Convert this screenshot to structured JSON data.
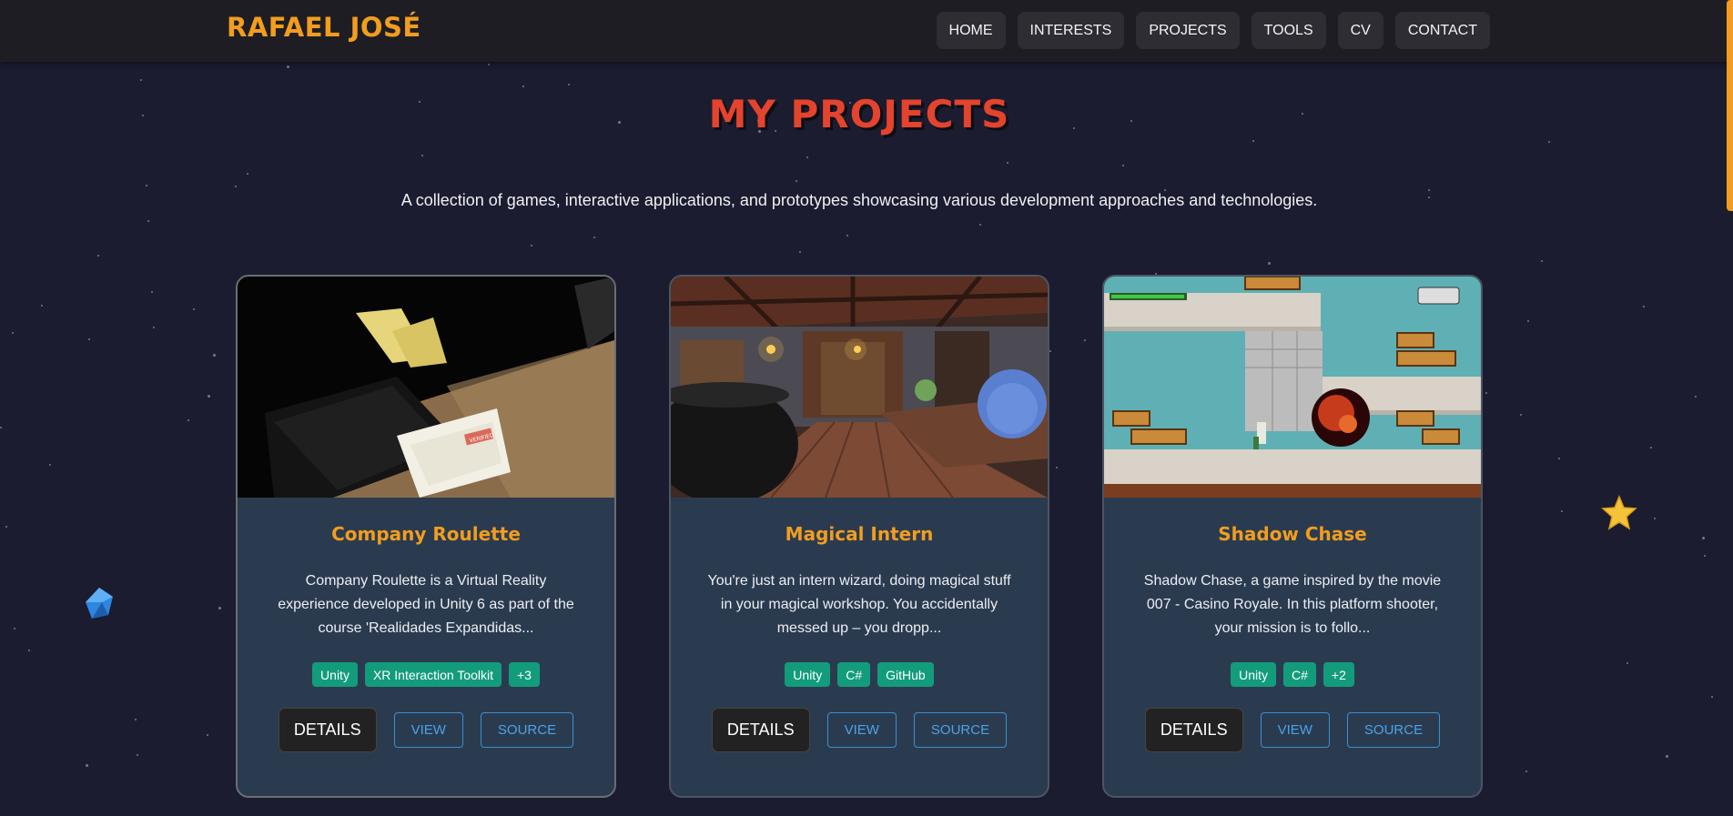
{
  "header": {
    "brand": "RAFAEL JOSÉ",
    "nav": [
      "HOME",
      "INTERESTS",
      "PROJECTS",
      "TOOLS",
      "CV",
      "CONTACT"
    ]
  },
  "page": {
    "title": "MY PROJECTS",
    "subtitle": "A collection of games, interactive applications, and prototypes showcasing various development approaches and technologies."
  },
  "projects": [
    {
      "title": "Company Roulette",
      "description": "Company Roulette is a Virtual Reality experience developed in Unity 6 as part of the course 'Realidades Expandidas...",
      "tags": [
        "Unity",
        "XR Interaction Toolkit",
        "+3"
      ],
      "thumbnail_stamp": "VERIFIED",
      "buttons": {
        "details": "DETAILS",
        "view": "VIEW",
        "source": "SOURCE"
      }
    },
    {
      "title": "Magical Intern",
      "description": "You're just an intern wizard, doing magical stuff in your magical workshop. You accidentally messed up – you dropp...",
      "tags": [
        "Unity",
        "C#",
        "GitHub"
      ],
      "buttons": {
        "details": "DETAILS",
        "view": "VIEW",
        "source": "SOURCE"
      }
    },
    {
      "title": "Shadow Chase",
      "description": "Shadow Chase, a game inspired by the movie 007 - Casino Royale. In this platform shooter, your mission is to follo...",
      "tags": [
        "Unity",
        "C#",
        "+2"
      ],
      "buttons": {
        "details": "DETAILS",
        "view": "VIEW",
        "source": "SOURCE"
      }
    }
  ],
  "colors": {
    "background": "#1b1c30",
    "accent": "#f29d1f",
    "title": "#e4432d",
    "card": "#2b3b4f",
    "tag": "#139c7c",
    "link": "#4aa3e8"
  },
  "icons": [
    "gem-icon",
    "star-icon"
  ]
}
